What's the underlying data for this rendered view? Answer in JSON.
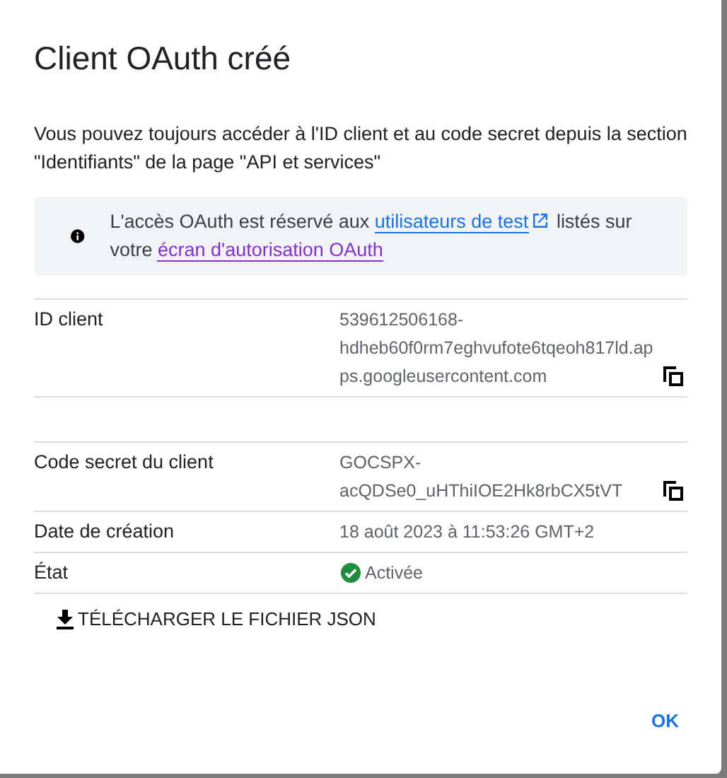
{
  "dialog": {
    "title": "Client OAuth créé",
    "description": "Vous pouvez toujours accéder à l'ID client et au code secret depuis la section \"Identifiants\" de la page \"API et services\"",
    "notice": {
      "before": "L'accès OAuth est réservé aux ",
      "link_1": "utilisateurs de test",
      "middle": " listés sur votre ",
      "link_2": "écran d'autorisation OAuth"
    },
    "fields": [
      {
        "label": "ID client",
        "value": "539612506168-hdheb60f0rm7eghvufote6tqeoh817ld.apps.googleusercontent.com",
        "kind": "copyable",
        "spaced": true
      },
      {
        "label": "Code secret du client",
        "value": "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",
        "kind": "copyable",
        "spaced": false
      },
      {
        "label": "Date de création",
        "value": "18 août 2023 à 11:53:26 GMT+2",
        "kind": "text",
        "spaced": false
      },
      {
        "label": "État",
        "value": "Activée",
        "kind": "status",
        "spaced": false
      }
    ],
    "download_button": "TÉLÉCHARGER LE FICHIER JSON",
    "ok_button": "OK"
  }
}
